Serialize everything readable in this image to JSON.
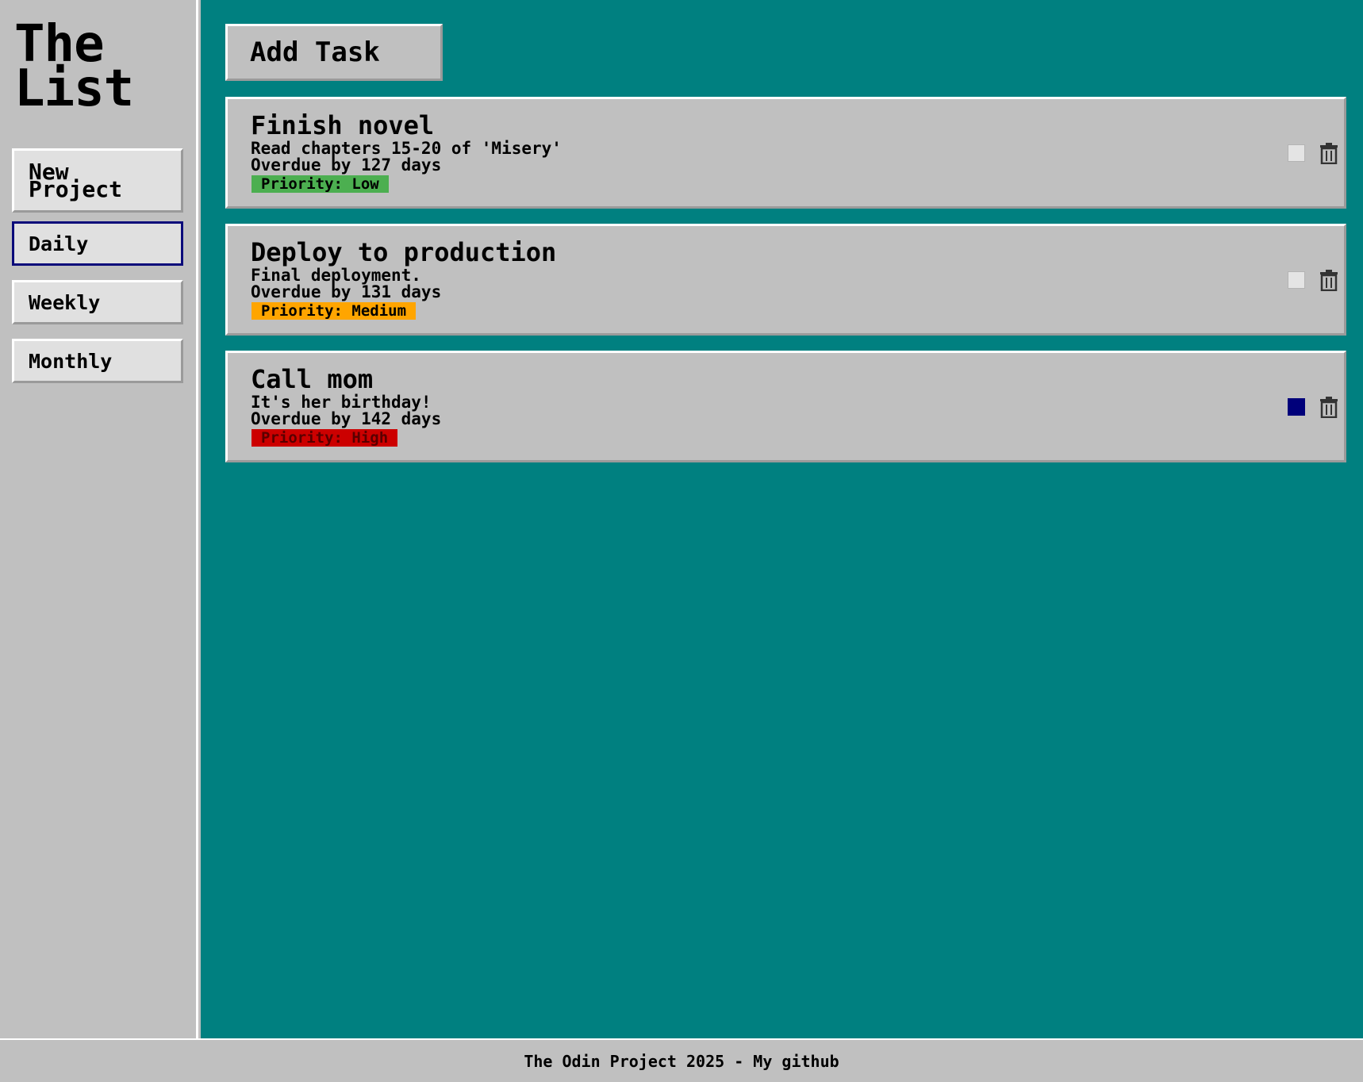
{
  "sidebar": {
    "logo": "The\nList",
    "new_project_label": "New Project",
    "projects": [
      {
        "label": "Daily",
        "active": true
      },
      {
        "label": "Weekly",
        "active": false
      },
      {
        "label": "Monthly",
        "active": false
      }
    ]
  },
  "main": {
    "add_task_label": "Add Task",
    "tasks": [
      {
        "title": "Finish novel",
        "description": "Read chapters 15-20 of 'Misery'",
        "due": "Overdue by 127 days",
        "priority": "Priority: Low",
        "priority_color": "#4caf50",
        "priority_text_color": "#000000",
        "done": false,
        "delete_icon": "trash-icon"
      },
      {
        "title": "Deploy to production",
        "description": "Final deployment.",
        "due": "Overdue by 131 days",
        "priority": "Priority: Medium",
        "priority_color": "#ffa500",
        "priority_text_color": "#000000",
        "done": false,
        "delete_icon": "trash-icon"
      },
      {
        "title": "Call mom",
        "description": "It's her birthday!",
        "due": "Overdue by 142 days",
        "priority": "Priority: High",
        "priority_color": "#cc0000",
        "priority_text_color": "#5a0000",
        "done": true,
        "delete_icon": "trash-icon"
      }
    ]
  },
  "footer": {
    "text": "The Odin Project 2025 - ",
    "link_label": "My github"
  },
  "colors": {
    "background_main": "#008080",
    "panel": "#c0c0c0",
    "checked": "#00007a"
  }
}
